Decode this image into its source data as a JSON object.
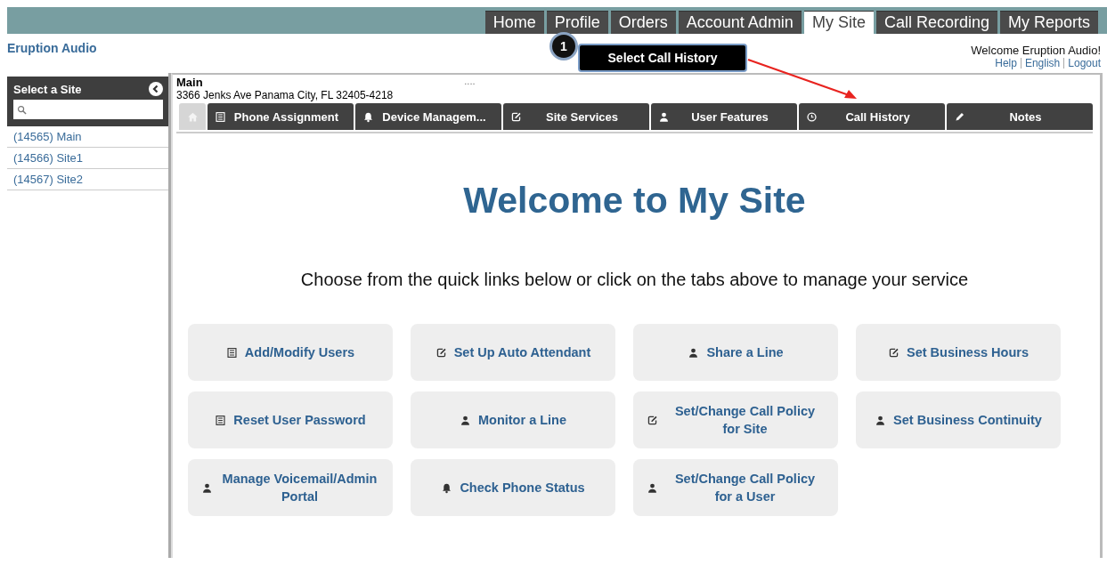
{
  "top_nav": [
    {
      "label": "Home",
      "selected": false
    },
    {
      "label": "Profile",
      "selected": false
    },
    {
      "label": "Orders",
      "selected": false
    },
    {
      "label": "Account Admin",
      "selected": false
    },
    {
      "label": "My Site",
      "selected": true
    },
    {
      "label": "Call Recording",
      "selected": false
    },
    {
      "label": "My Reports",
      "selected": false
    }
  ],
  "brand": "Eruption Audio",
  "welcome": "Welcome Eruption Audio!",
  "user_links": [
    "Help",
    "English",
    "Logout"
  ],
  "callout": {
    "number": "1",
    "text": "Select Call History"
  },
  "sidebar": {
    "title": "Select a Site",
    "items": [
      {
        "label": "(14565) Main"
      },
      {
        "label": "(14566) Site1"
      },
      {
        "label": "(14567) Site2"
      }
    ]
  },
  "site": {
    "name": "Main",
    "address": "3366 Jenks Ave Panama City, FL 32405-4218",
    "more": "...."
  },
  "site_tabs": [
    {
      "kind": "home",
      "selected": true
    },
    {
      "kind": "list",
      "label": "Phone Assignment",
      "selected": false
    },
    {
      "kind": "bell",
      "label": "Device Managem...",
      "selected": false
    },
    {
      "kind": "edit",
      "label": "Site Services",
      "selected": false
    },
    {
      "kind": "user",
      "label": "User Features",
      "selected": false
    },
    {
      "kind": "clock",
      "label": "Call History",
      "selected": false
    },
    {
      "kind": "pencil",
      "label": "Notes",
      "selected": false
    }
  ],
  "heading": "Welcome to My Site",
  "subheading": "Choose from the quick links below or click on the tabs above to manage your service",
  "quick_links": [
    {
      "kind": "list",
      "label": "Add/Modify Users"
    },
    {
      "kind": "edit",
      "label": "Set Up Auto Attendant"
    },
    {
      "kind": "user",
      "label": "Share a Line"
    },
    {
      "kind": "edit",
      "label": "Set Business Hours"
    },
    {
      "kind": "list",
      "label": "Reset User Password"
    },
    {
      "kind": "user",
      "label": "Monitor a Line"
    },
    {
      "kind": "edit",
      "label": "Set/Change Call Policy for Site"
    },
    {
      "kind": "user",
      "label": "Set Business Continuity"
    },
    {
      "kind": "user",
      "label": "Manage Voicemail/Admin Portal"
    },
    {
      "kind": "bell",
      "label": "Check Phone Status"
    },
    {
      "kind": "user",
      "label": "Set/Change Call Policy for a User"
    }
  ]
}
